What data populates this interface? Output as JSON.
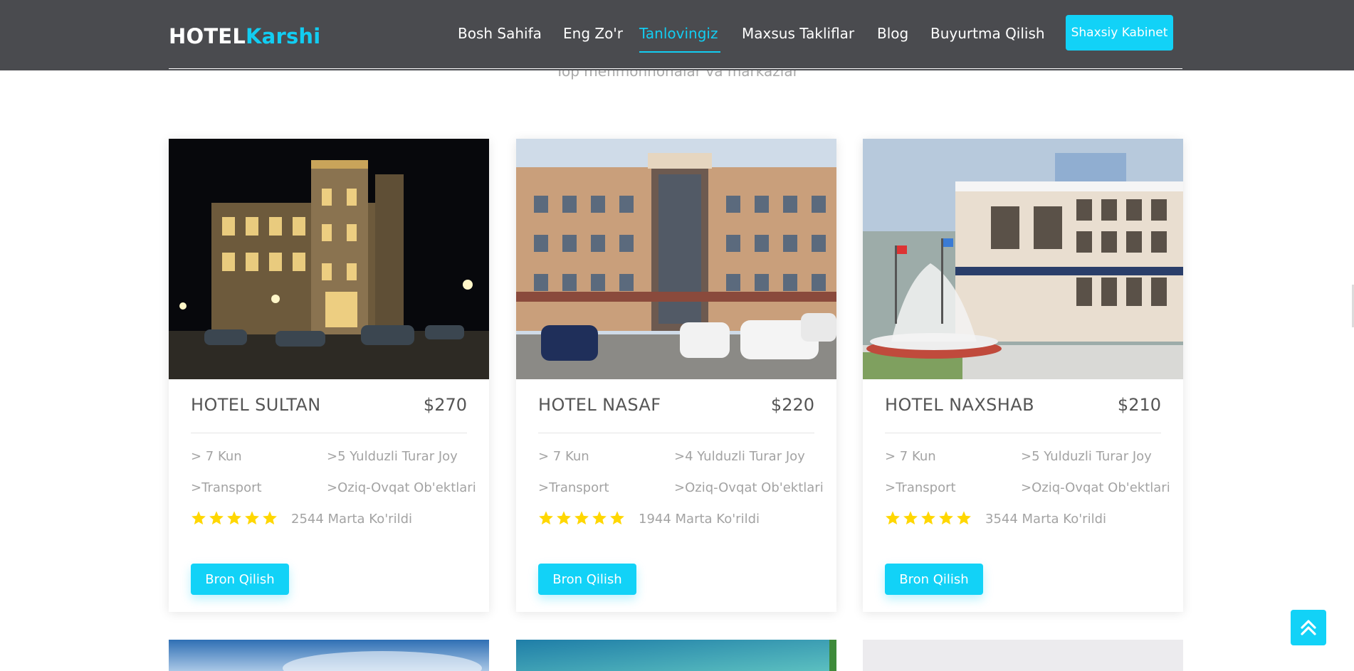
{
  "header": {
    "logo_part1": "HOTEL",
    "logo_part2": "Karshi",
    "nav": [
      "Bosh Sahifa",
      "Eng Zo'r",
      "Tanlovingiz",
      "Maxsus Takliflar",
      "Blog",
      "Buyurtma Qilish"
    ],
    "active_nav": "Tanlovingiz",
    "cabinet_label": "Shaxsiy Kabinet"
  },
  "section": {
    "subtitle": "Top mehmonhonalar va markazlar"
  },
  "hotels": [
    {
      "name": "HOTEL SULTAN",
      "price": "$270",
      "duration": "> 7 Kun",
      "stars_text": ">5 Yulduzli Turar Joy",
      "transport": ">Transport",
      "food": ">Oziq-Ovqat Ob'ektlari",
      "rating": 5,
      "views": "2544 Marta Ko'rildi",
      "button": "Bron Qilish"
    },
    {
      "name": "HOTEL NASAF",
      "price": "$220",
      "duration": "> 7 Kun",
      "stars_text": ">4 Yulduzli Turar Joy",
      "transport": ">Transport",
      "food": ">Oziq-Ovqat Ob'ektlari",
      "rating": 5,
      "views": "1944 Marta Ko'rildi",
      "button": "Bron Qilish"
    },
    {
      "name": "HOTEL NAXSHAB",
      "price": "$210",
      "duration": "> 7 Kun",
      "stars_text": ">5 Yulduzli Turar Joy",
      "transport": ">Transport",
      "food": ">Oziq-Ovqat Ob'ektlari",
      "rating": 5,
      "views": "3544 Marta Ko'rildi",
      "button": "Bron Qilish"
    }
  ],
  "colors": {
    "accent": "#12cdf2",
    "header_bg": "#4a4b4f",
    "star": "#ffd700"
  },
  "icons": {
    "scroll_top": "double-chevron-up-icon",
    "rating": "star-icon"
  }
}
